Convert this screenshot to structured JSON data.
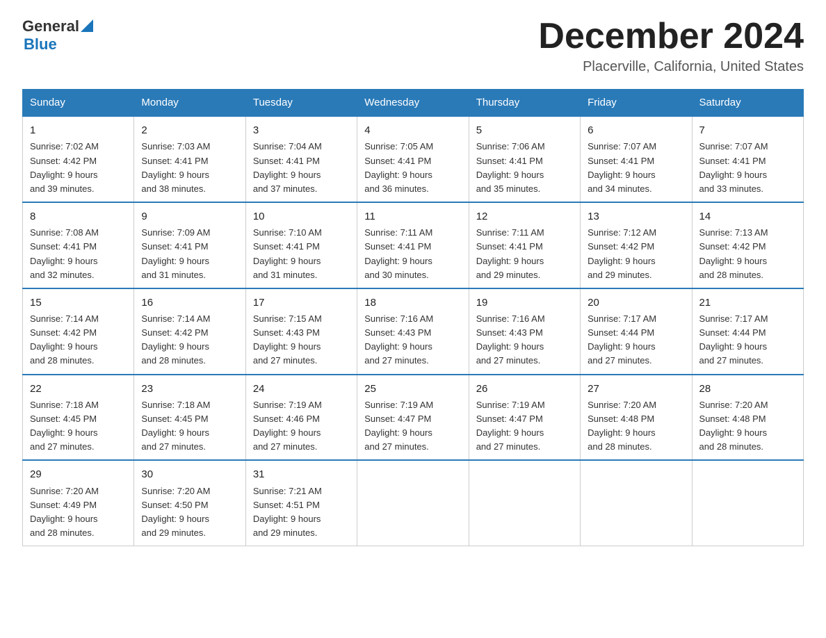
{
  "header": {
    "logo": {
      "general": "General",
      "blue": "Blue",
      "line2": "Blue"
    },
    "month_title": "December 2024",
    "location": "Placerville, California, United States"
  },
  "weekdays": [
    "Sunday",
    "Monday",
    "Tuesday",
    "Wednesday",
    "Thursday",
    "Friday",
    "Saturday"
  ],
  "weeks": [
    [
      {
        "day": "1",
        "sunrise": "7:02 AM",
        "sunset": "4:42 PM",
        "daylight": "9 hours and 39 minutes."
      },
      {
        "day": "2",
        "sunrise": "7:03 AM",
        "sunset": "4:41 PM",
        "daylight": "9 hours and 38 minutes."
      },
      {
        "day": "3",
        "sunrise": "7:04 AM",
        "sunset": "4:41 PM",
        "daylight": "9 hours and 37 minutes."
      },
      {
        "day": "4",
        "sunrise": "7:05 AM",
        "sunset": "4:41 PM",
        "daylight": "9 hours and 36 minutes."
      },
      {
        "day": "5",
        "sunrise": "7:06 AM",
        "sunset": "4:41 PM",
        "daylight": "9 hours and 35 minutes."
      },
      {
        "day": "6",
        "sunrise": "7:07 AM",
        "sunset": "4:41 PM",
        "daylight": "9 hours and 34 minutes."
      },
      {
        "day": "7",
        "sunrise": "7:07 AM",
        "sunset": "4:41 PM",
        "daylight": "9 hours and 33 minutes."
      }
    ],
    [
      {
        "day": "8",
        "sunrise": "7:08 AM",
        "sunset": "4:41 PM",
        "daylight": "9 hours and 32 minutes."
      },
      {
        "day": "9",
        "sunrise": "7:09 AM",
        "sunset": "4:41 PM",
        "daylight": "9 hours and 31 minutes."
      },
      {
        "day": "10",
        "sunrise": "7:10 AM",
        "sunset": "4:41 PM",
        "daylight": "9 hours and 31 minutes."
      },
      {
        "day": "11",
        "sunrise": "7:11 AM",
        "sunset": "4:41 PM",
        "daylight": "9 hours and 30 minutes."
      },
      {
        "day": "12",
        "sunrise": "7:11 AM",
        "sunset": "4:41 PM",
        "daylight": "9 hours and 29 minutes."
      },
      {
        "day": "13",
        "sunrise": "7:12 AM",
        "sunset": "4:42 PM",
        "daylight": "9 hours and 29 minutes."
      },
      {
        "day": "14",
        "sunrise": "7:13 AM",
        "sunset": "4:42 PM",
        "daylight": "9 hours and 28 minutes."
      }
    ],
    [
      {
        "day": "15",
        "sunrise": "7:14 AM",
        "sunset": "4:42 PM",
        "daylight": "9 hours and 28 minutes."
      },
      {
        "day": "16",
        "sunrise": "7:14 AM",
        "sunset": "4:42 PM",
        "daylight": "9 hours and 28 minutes."
      },
      {
        "day": "17",
        "sunrise": "7:15 AM",
        "sunset": "4:43 PM",
        "daylight": "9 hours and 27 minutes."
      },
      {
        "day": "18",
        "sunrise": "7:16 AM",
        "sunset": "4:43 PM",
        "daylight": "9 hours and 27 minutes."
      },
      {
        "day": "19",
        "sunrise": "7:16 AM",
        "sunset": "4:43 PM",
        "daylight": "9 hours and 27 minutes."
      },
      {
        "day": "20",
        "sunrise": "7:17 AM",
        "sunset": "4:44 PM",
        "daylight": "9 hours and 27 minutes."
      },
      {
        "day": "21",
        "sunrise": "7:17 AM",
        "sunset": "4:44 PM",
        "daylight": "9 hours and 27 minutes."
      }
    ],
    [
      {
        "day": "22",
        "sunrise": "7:18 AM",
        "sunset": "4:45 PM",
        "daylight": "9 hours and 27 minutes."
      },
      {
        "day": "23",
        "sunrise": "7:18 AM",
        "sunset": "4:45 PM",
        "daylight": "9 hours and 27 minutes."
      },
      {
        "day": "24",
        "sunrise": "7:19 AM",
        "sunset": "4:46 PM",
        "daylight": "9 hours and 27 minutes."
      },
      {
        "day": "25",
        "sunrise": "7:19 AM",
        "sunset": "4:47 PM",
        "daylight": "9 hours and 27 minutes."
      },
      {
        "day": "26",
        "sunrise": "7:19 AM",
        "sunset": "4:47 PM",
        "daylight": "9 hours and 27 minutes."
      },
      {
        "day": "27",
        "sunrise": "7:20 AM",
        "sunset": "4:48 PM",
        "daylight": "9 hours and 28 minutes."
      },
      {
        "day": "28",
        "sunrise": "7:20 AM",
        "sunset": "4:48 PM",
        "daylight": "9 hours and 28 minutes."
      }
    ],
    [
      {
        "day": "29",
        "sunrise": "7:20 AM",
        "sunset": "4:49 PM",
        "daylight": "9 hours and 28 minutes."
      },
      {
        "day": "30",
        "sunrise": "7:20 AM",
        "sunset": "4:50 PM",
        "daylight": "9 hours and 29 minutes."
      },
      {
        "day": "31",
        "sunrise": "7:21 AM",
        "sunset": "4:51 PM",
        "daylight": "9 hours and 29 minutes."
      },
      null,
      null,
      null,
      null
    ]
  ]
}
